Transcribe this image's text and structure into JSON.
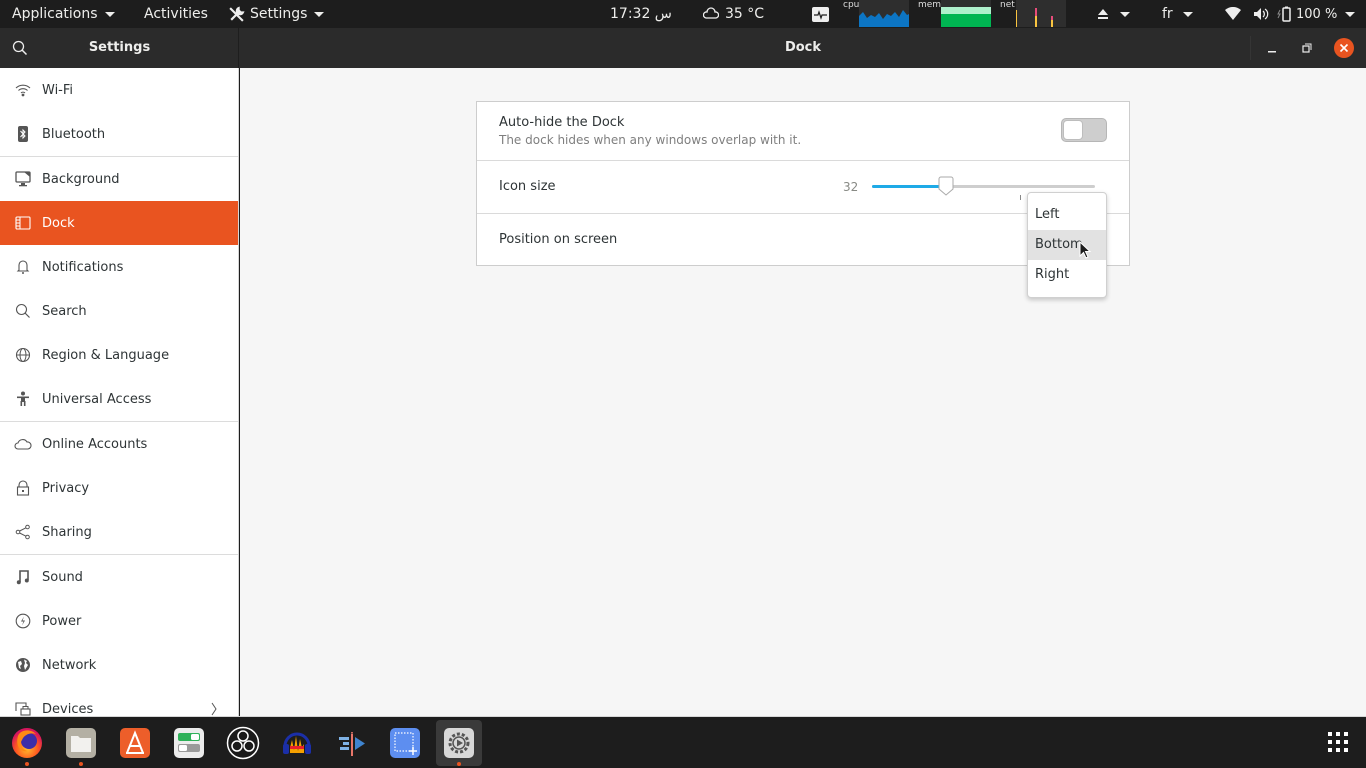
{
  "topbar": {
    "applications": "Applications",
    "activities": "Activities",
    "app_menu": "Settings",
    "clock": "17:32 س",
    "weather": "35 °C",
    "graphs": {
      "cpu": "cpu",
      "mem": "mem",
      "net": "net"
    },
    "keyboard_layout": "fr",
    "battery": "100 %"
  },
  "headerbar": {
    "sidebar_title": "Settings",
    "main_title": "Dock"
  },
  "sidebar": {
    "items": [
      {
        "label": "Wi-Fi",
        "icon": "wifi-icon"
      },
      {
        "label": "Bluetooth",
        "icon": "bluetooth-icon"
      },
      {
        "label": "Background",
        "icon": "background-icon"
      },
      {
        "label": "Dock",
        "icon": "dock-icon",
        "active": true
      },
      {
        "label": "Notifications",
        "icon": "bell-icon"
      },
      {
        "label": "Search",
        "icon": "search-icon"
      },
      {
        "label": "Region & Language",
        "icon": "globe-icon"
      },
      {
        "label": "Universal Access",
        "icon": "accessibility-icon"
      },
      {
        "label": "Online Accounts",
        "icon": "cloud-icon"
      },
      {
        "label": "Privacy",
        "icon": "lock-icon"
      },
      {
        "label": "Sharing",
        "icon": "share-icon"
      },
      {
        "label": "Sound",
        "icon": "music-note-icon"
      },
      {
        "label": "Power",
        "icon": "power-icon"
      },
      {
        "label": "Network",
        "icon": "network-icon"
      },
      {
        "label": "Devices",
        "icon": "devices-icon"
      }
    ]
  },
  "dock_settings": {
    "autohide": {
      "title": "Auto-hide the Dock",
      "subtitle": "The dock hides when any windows overlap with it.",
      "enabled": false
    },
    "icon_size": {
      "label": "Icon size",
      "value": "32",
      "range": [
        16,
        64
      ],
      "fraction": 0.33
    },
    "position": {
      "label": "Position on screen",
      "options": [
        "Left",
        "Bottom",
        "Right"
      ],
      "hovered": "Bottom"
    }
  },
  "dock": {
    "apps": [
      {
        "name": "Firefox",
        "running": true
      },
      {
        "name": "Files",
        "running": true
      },
      {
        "name": "Ubuntu Software",
        "running": false
      },
      {
        "name": "Tweaks",
        "running": false
      },
      {
        "name": "OBS Studio",
        "running": false
      },
      {
        "name": "Audacity",
        "running": false
      },
      {
        "name": "Kdenlive",
        "running": false
      },
      {
        "name": "Screenshot",
        "running": false
      },
      {
        "name": "Settings",
        "running": true,
        "active": true
      }
    ]
  },
  "colors": {
    "accent": "#e95420",
    "slider_fill": "#1eaae7",
    "panel_bg": "#1d1d1d"
  }
}
